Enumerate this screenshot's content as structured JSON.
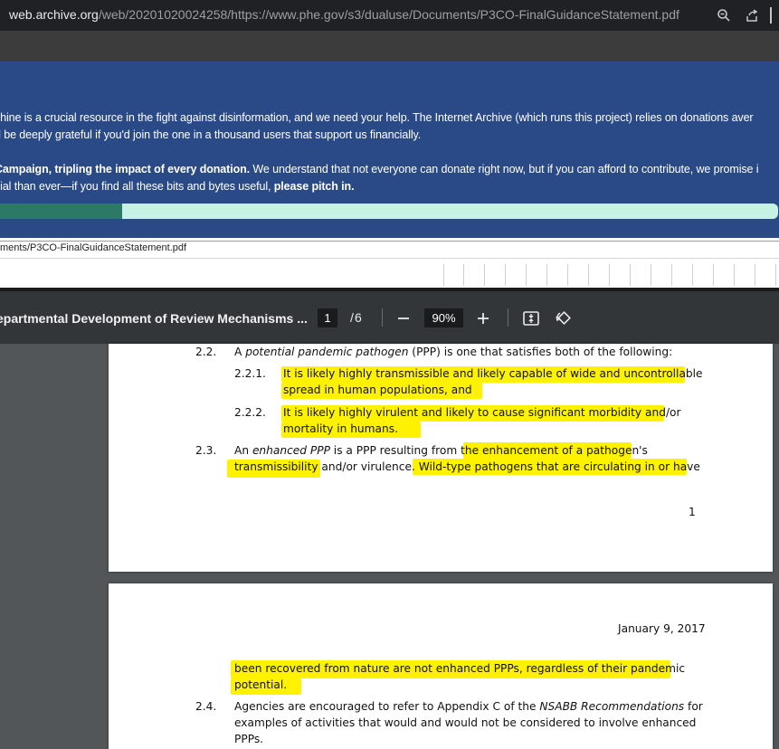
{
  "browser": {
    "url_domain": "web.archive.org",
    "url_path": "/web/20201020024258/https://www.phe.gov/s3/dualuse/Documents/P3CO-FinalGuidanceStatement.pdf"
  },
  "banner": {
    "line1": "chine is a crucial resource in the fight against disinformation, and we need your help. The Internet Archive (which runs this project) relies on donations aver",
    "line2": "d be deeply grateful if you'd join the one in a thousand users that support us financially.",
    "line3_bold": "Campaign, tripling the impact of every donation.",
    "line3_rest": " We understand that not everyone can donate right now, but if you can afford to contribute, we promise i",
    "line4_start": "cial than ever—if you find all these bits and bytes useful, ",
    "line4_bold": "please pitch in.",
    "progress": 0.157,
    "colors": {
      "background": "#2a4a87",
      "progress_fill": "#2c7a66",
      "progress_track": "#c5f2e5"
    }
  },
  "wayback": {
    "url_text": "ments/P3CO-FinalGuidanceStatement.pdf"
  },
  "pdf_toolbar": {
    "title": "epartmental Development of Review Mechanisms ...",
    "current_page": "1",
    "page_separator": "/",
    "total_pages": "6",
    "zoom": "90%"
  },
  "page1": {
    "s22_num": "2.2.",
    "s22_a": "A ",
    "s22_italic": "potential pandemic pathogen",
    "s22_b": " (PPP) is one that satisfies both of the following:",
    "s221_num": "2.2.1.",
    "s221_line1": "It is likely highly transmissible and likely capable of wide and uncontrollable",
    "s221_line2": "spread in human populations, and",
    "s222_num": "2.2.2.",
    "s222_line1": "It is likely highly virulent and likely to cause significant morbidity and/or",
    "s222_line2": "mortality in humans.",
    "s23_num": "2.3.",
    "s23_a": "An ",
    "s23_italic": "enhanced PPP",
    "s23_b": " is a PPP resulting from the enhancement of a pathogen's",
    "s23_line2": "transmissibility and/or virulence.  Wild-type pathogens that are circulating in or have",
    "page_number": "1"
  },
  "page2": {
    "date": "January 9, 2017",
    "cont_line1": "been recovered from nature are not enhanced PPPs, regardless of their pandemic",
    "cont_line2": "potential.",
    "s24_num": "2.4.",
    "s24_a": "Agencies are encouraged to refer to Appendix C of the ",
    "s24_italic": "NSABB Recommendations",
    "s24_b": " for",
    "s24_line2": "examples of activities that would and would not be considered to involve enhanced",
    "s24_line3": "PPPs."
  },
  "highlight_color": "#fef200"
}
